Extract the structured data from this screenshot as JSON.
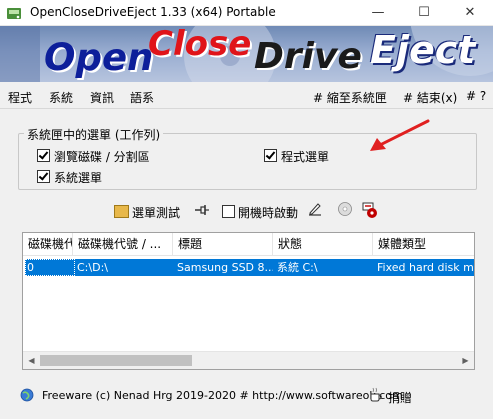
{
  "window": {
    "title": "OpenCloseDriveEject 1.33  (x64) Portable",
    "controls": {
      "minimize": "—",
      "maximize": "☐",
      "close": "✕"
    }
  },
  "banner": {
    "open": "Open",
    "close": "Close",
    "drive": "Drive",
    "eject": "Eject"
  },
  "menu": {
    "left": [
      "程式",
      "系統",
      "資訊",
      "語系"
    ],
    "minimize_to_tray": "# 縮至系統匣",
    "exit": "# 結束(x)",
    "help": "# ?"
  },
  "group": {
    "title": "系統匣中的選單 (工作列)",
    "browse_drives": "瀏覽磁碟 / 分割區",
    "program_menu": "程式選單",
    "system_menu": "系統選單"
  },
  "toolbar": {
    "menu_test": "選單測試",
    "start_on_boot": "開機時啟動"
  },
  "list": {
    "columns": [
      "磁碟機代號 /",
      "磁碟機代號 / ...",
      "標題",
      "狀態",
      "媒體類型"
    ],
    "rows": [
      {
        "index": "0",
        "drives": "C:\\D:\\",
        "title": "Samsung SSD 8...",
        "status": "系統 C:\\",
        "media": "Fixed hard disk media"
      }
    ],
    "scroll_left": "◀",
    "scroll_right": "▶"
  },
  "footer": {
    "text": "Freeware (c) Nenad Hrg 2019-2020 # http://www.softwareok.com",
    "donate": "捐贈"
  },
  "colors": {
    "selection": "#0078d7",
    "arrow": "#e02020"
  }
}
